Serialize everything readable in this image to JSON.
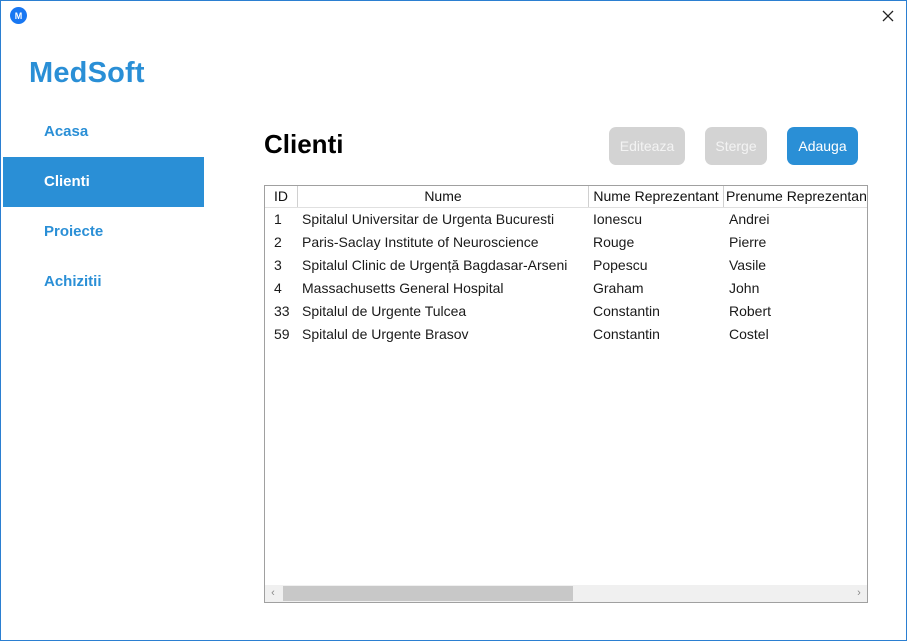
{
  "app": {
    "brand": "MedSoft",
    "icon_letter": "M"
  },
  "sidebar": {
    "items": [
      {
        "label": "Acasa"
      },
      {
        "label": "Clienti"
      },
      {
        "label": "Proiecte"
      },
      {
        "label": "Achizitii"
      }
    ],
    "active": "Clienti"
  },
  "main": {
    "title": "Clienti",
    "buttons": {
      "edit": "Editeaza",
      "delete": "Sterge",
      "add": "Adauga"
    }
  },
  "table": {
    "columns": [
      "ID",
      "Nume",
      "Nume Reprezentant",
      "Prenume Reprezentant"
    ],
    "rows": [
      {
        "id": "1",
        "nume": "Spitalul Universitar de Urgenta Bucuresti",
        "nume_rep": "Ionescu",
        "prenume_rep": "Andrei"
      },
      {
        "id": "2",
        "nume": "Paris-Saclay Institute of Neuroscience",
        "nume_rep": "Rouge",
        "prenume_rep": "Pierre"
      },
      {
        "id": "3",
        "nume": "Spitalul Clinic de Urgență Bagdasar-Arseni",
        "nume_rep": "Popescu",
        "prenume_rep": "Vasile"
      },
      {
        "id": "4",
        "nume": "Massachusetts General Hospital",
        "nume_rep": "Graham",
        "prenume_rep": "John"
      },
      {
        "id": "33",
        "nume": "Spitalul de Urgente Tulcea",
        "nume_rep": "Constantin",
        "prenume_rep": "Robert"
      },
      {
        "id": "59",
        "nume": "Spitalul de Urgente Brasov",
        "nume_rep": "Constantin",
        "prenume_rep": "Costel"
      }
    ]
  },
  "colors": {
    "accent": "#2a8fd6",
    "disabled_button": "#d3d3d3",
    "window_border": "#2b7fd1"
  },
  "icons": {
    "app": "app-logo-icon",
    "close": "close-icon",
    "scroll_left": "chevron-left-icon",
    "scroll_right": "chevron-right-icon"
  }
}
